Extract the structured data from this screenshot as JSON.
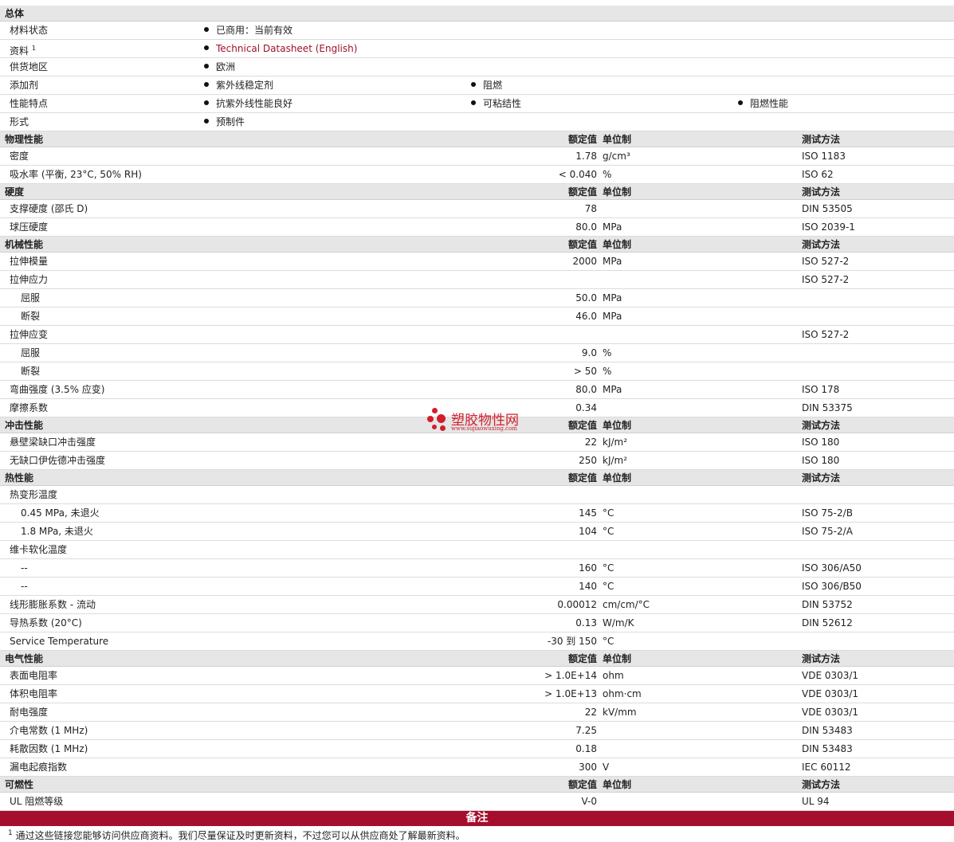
{
  "general": {
    "title": "总体",
    "rows": [
      {
        "label": "材料状态",
        "items": [
          "已商用：当前有效"
        ]
      },
      {
        "label": "资料",
        "sup": "1",
        "items": [
          "Technical Datasheet (English)"
        ],
        "link": true
      },
      {
        "label": "供货地区",
        "items": [
          "欧洲"
        ]
      },
      {
        "label": "添加剂",
        "items": [
          "紫外线稳定剂",
          "阻燃"
        ]
      },
      {
        "label": "性能特点",
        "items": [
          "抗紫外线性能良好",
          "可粘结性",
          "阻燃性能"
        ]
      },
      {
        "label": "形式",
        "items": [
          "预制件"
        ]
      }
    ]
  },
  "columns": {
    "value": "额定值",
    "unit": "单位制",
    "method": "测试方法"
  },
  "sections": [
    {
      "title": "物理性能",
      "rows": [
        {
          "label": "密度",
          "value": "1.78",
          "unit": "g/cm³",
          "method": "ISO 1183"
        },
        {
          "label": "吸水率 (平衡, 23°C, 50% RH)",
          "value": "< 0.040",
          "unit": "%",
          "method": "ISO 62"
        }
      ]
    },
    {
      "title": "硬度",
      "rows": [
        {
          "label": "支撑硬度 (邵氏 D)",
          "value": "78",
          "unit": "",
          "method": "DIN 53505"
        },
        {
          "label": "球压硬度",
          "value": "80.0",
          "unit": "MPa",
          "method": "ISO 2039-1"
        }
      ]
    },
    {
      "title": "机械性能",
      "rows": [
        {
          "label": "拉伸模量",
          "value": "2000",
          "unit": "MPa",
          "method": "ISO 527-2"
        },
        {
          "label": "拉伸应力",
          "value": "",
          "unit": "",
          "method": "ISO 527-2"
        },
        {
          "label": "屈服",
          "sub": true,
          "value": "50.0",
          "unit": "MPa",
          "method": ""
        },
        {
          "label": "断裂",
          "sub": true,
          "value": "46.0",
          "unit": "MPa",
          "method": ""
        },
        {
          "label": "拉伸应变",
          "value": "",
          "unit": "",
          "method": "ISO 527-2"
        },
        {
          "label": "屈服",
          "sub": true,
          "value": "9.0",
          "unit": "%",
          "method": ""
        },
        {
          "label": "断裂",
          "sub": true,
          "value": "> 50",
          "unit": "%",
          "method": ""
        },
        {
          "label": "弯曲强度 (3.5% 应变)",
          "value": "80.0",
          "unit": "MPa",
          "method": "ISO 178"
        },
        {
          "label": "摩擦系数",
          "value": "0.34",
          "unit": "",
          "method": "DIN 53375"
        }
      ]
    },
    {
      "title": "冲击性能",
      "rows": [
        {
          "label": "悬壁梁缺口冲击强度",
          "value": "22",
          "unit": "kJ/m²",
          "method": "ISO 180"
        },
        {
          "label": "无缺口伊佐德冲击强度",
          "value": "250",
          "unit": "kJ/m²",
          "method": "ISO 180"
        }
      ]
    },
    {
      "title": "热性能",
      "rows": [
        {
          "label": "热变形温度",
          "value": "",
          "unit": "",
          "method": ""
        },
        {
          "label": "0.45 MPa, 未退火",
          "sub": true,
          "value": "145",
          "unit": "°C",
          "method": "ISO 75-2/B"
        },
        {
          "label": "1.8 MPa, 未退火",
          "sub": true,
          "value": "104",
          "unit": "°C",
          "method": "ISO 75-2/A"
        },
        {
          "label": "维卡软化温度",
          "value": "",
          "unit": "",
          "method": ""
        },
        {
          "label": "--",
          "sub": true,
          "value": "160",
          "unit": "°C",
          "method": "ISO 306/A50"
        },
        {
          "label": "--",
          "sub": true,
          "value": "140",
          "unit": "°C",
          "method": "ISO 306/B50"
        },
        {
          "label": "线形膨胀系数 - 流动",
          "value": "0.00012",
          "unit": "cm/cm/°C",
          "method": "DIN 53752"
        },
        {
          "label": "导热系数 (20°C)",
          "value": "0.13",
          "unit": "W/m/K",
          "method": "DIN 52612"
        },
        {
          "label": "Service Temperature",
          "value": "-30 到  150",
          "unit": "°C",
          "method": ""
        }
      ]
    },
    {
      "title": "电气性能",
      "rows": [
        {
          "label": "表面电阻率",
          "value": "> 1.0E+14",
          "unit": "ohm",
          "method": "VDE 0303/1"
        },
        {
          "label": "体积电阻率",
          "value": "> 1.0E+13",
          "unit": "ohm·cm",
          "method": "VDE 0303/1"
        },
        {
          "label": "耐电强度",
          "value": "22",
          "unit": "kV/mm",
          "method": "VDE 0303/1"
        },
        {
          "label": "介电常数 (1 MHz)",
          "value": "7.25",
          "unit": "",
          "method": "DIN 53483"
        },
        {
          "label": "耗散因数 (1 MHz)",
          "value": "0.18",
          "unit": "",
          "method": "DIN 53483"
        },
        {
          "label": "漏电起痕指数",
          "value": "300",
          "unit": "V",
          "method": "IEC 60112"
        }
      ]
    },
    {
      "title": "可燃性",
      "rows": [
        {
          "label": "UL 阻燃等级",
          "value": "V-0",
          "unit": "",
          "method": "UL 94"
        }
      ]
    }
  ],
  "notes": {
    "title": "备注",
    "footnote_num": "1",
    "footnote": "通过这些链接您能够访问供应商资料。我们尽量保证及时更新资料，不过您可以从供应商处了解最新资料。"
  },
  "watermark": {
    "brand": "塑胶物性网",
    "url": "www.sujiaowuxing.com",
    "color": "#d21e2b"
  },
  "colors": {
    "header_bg": "#e6e6e6",
    "notes_bar": "#a50f2d",
    "link": "#a0102a"
  }
}
